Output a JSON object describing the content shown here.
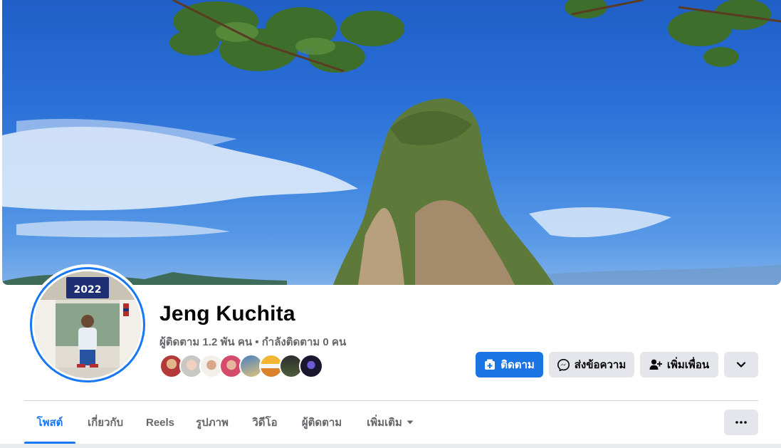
{
  "profile": {
    "name": "Jeng Kuchita",
    "followers_text": "ผู้ติดตาม 1.2 พัน คน • กำลังติดตาม 0 คน"
  },
  "actions": {
    "follow_label": "ติดตาม",
    "message_label": "ส่งข้อความ",
    "add_friend_label": "เพิ่มเพื่อน"
  },
  "tabs": [
    {
      "label": "โพสต์",
      "active": true
    },
    {
      "label": "เกี่ยวกับ"
    },
    {
      "label": "Reels"
    },
    {
      "label": "รูปภาพ"
    },
    {
      "label": "วิดีโอ"
    },
    {
      "label": "ผู้ติดตาม"
    },
    {
      "label": "เพิ่มเติม"
    }
  ],
  "avatar_banner_text": "2022",
  "colors": {
    "accent": "#1877f2",
    "primary_button": "#1b74e4",
    "secondary_button": "#e4e6eb",
    "muted_text": "#65676b"
  },
  "icons": [
    "follow-plus-icon",
    "messenger-icon",
    "add-friend-icon",
    "chevron-down-icon",
    "more-dots-icon",
    "caret-down-icon"
  ]
}
